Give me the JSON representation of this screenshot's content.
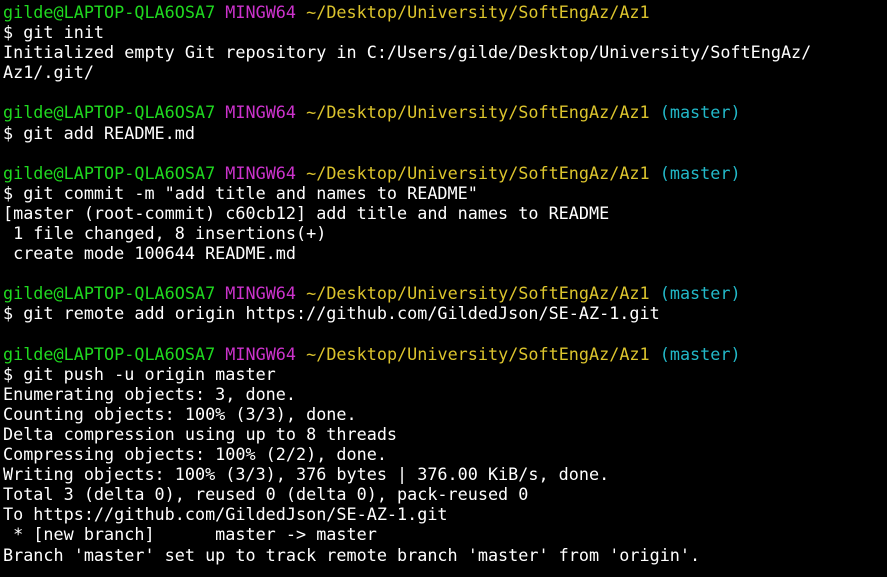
{
  "prompt": {
    "user_host": "gilde@LAPTOP-QLA6OSA7",
    "shell": "MINGW64",
    "path": "~/Desktop/University/SoftEngAz/Az1",
    "branch": "(master)"
  },
  "lines": [
    {
      "kind": "prompt",
      "branch": false
    },
    {
      "kind": "command",
      "text": "$ git init"
    },
    {
      "kind": "output",
      "text": "Initialized empty Git repository in C:/Users/gilde/Desktop/University/SoftEngAz/"
    },
    {
      "kind": "output",
      "text": "Az1/.git/"
    },
    {
      "kind": "blank",
      "text": ""
    },
    {
      "kind": "prompt",
      "branch": true
    },
    {
      "kind": "command",
      "text": "$ git add README.md"
    },
    {
      "kind": "blank",
      "text": ""
    },
    {
      "kind": "prompt",
      "branch": true
    },
    {
      "kind": "command",
      "text": "$ git commit -m \"add title and names to README\""
    },
    {
      "kind": "output",
      "text": "[master (root-commit) c60cb12] add title and names to README"
    },
    {
      "kind": "output",
      "text": " 1 file changed, 8 insertions(+)"
    },
    {
      "kind": "output",
      "text": " create mode 100644 README.md"
    },
    {
      "kind": "blank",
      "text": ""
    },
    {
      "kind": "prompt",
      "branch": true
    },
    {
      "kind": "command",
      "text": "$ git remote add origin https://github.com/GildedJson/SE-AZ-1.git"
    },
    {
      "kind": "blank",
      "text": ""
    },
    {
      "kind": "prompt",
      "branch": true
    },
    {
      "kind": "command",
      "text": "$ git push -u origin master"
    },
    {
      "kind": "output",
      "text": "Enumerating objects: 3, done."
    },
    {
      "kind": "output",
      "text": "Counting objects: 100% (3/3), done."
    },
    {
      "kind": "output",
      "text": "Delta compression using up to 8 threads"
    },
    {
      "kind": "output",
      "text": "Compressing objects: 100% (2/2), done."
    },
    {
      "kind": "output",
      "text": "Writing objects: 100% (3/3), 376 bytes | 376.00 KiB/s, done."
    },
    {
      "kind": "output",
      "text": "Total 3 (delta 0), reused 0 (delta 0), pack-reused 0"
    },
    {
      "kind": "output",
      "text": "To https://github.com/GildedJson/SE-AZ-1.git"
    },
    {
      "kind": "output",
      "text": " * [new branch]      master -> master"
    },
    {
      "kind": "output",
      "text": "Branch 'master' set up to track remote branch 'master' from 'origin'."
    }
  ]
}
